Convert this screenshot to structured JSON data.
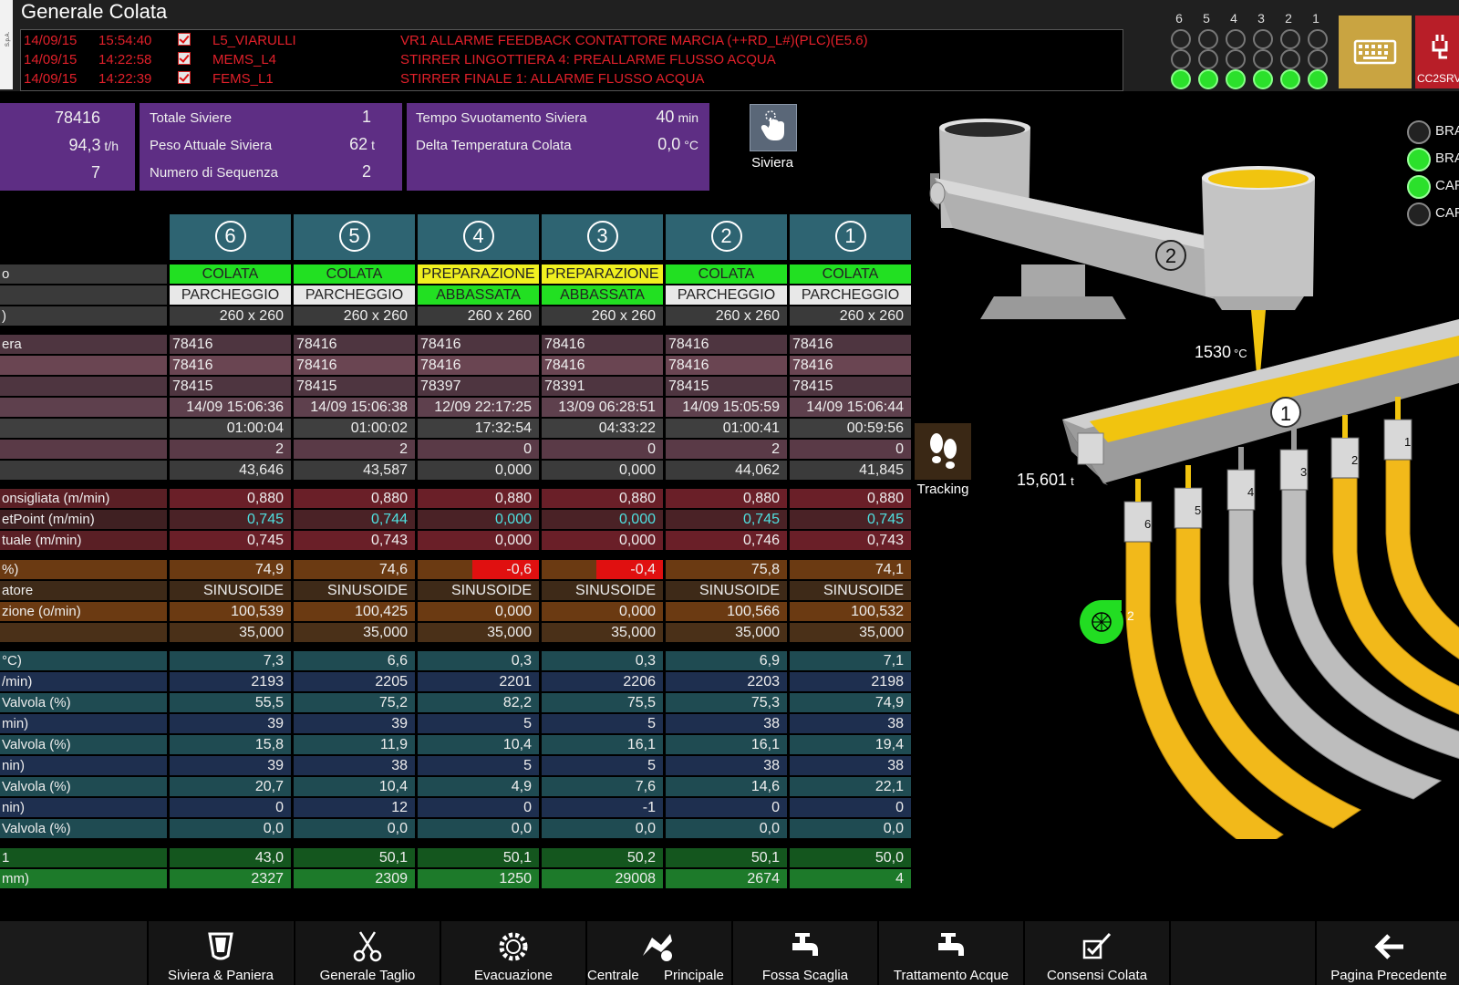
{
  "header": {
    "title": "Generale Colata",
    "logo_text": "S.p.A.",
    "alarms": [
      {
        "date": "14/09/15",
        "time": "15:54:40",
        "source": "L5_VIARULLI",
        "message": "VR1 ALLARME FEEDBACK CONTATTORE MARCIA (++RD_L#)(PLC)(E5.6)"
      },
      {
        "date": "14/09/15",
        "time": "14:22:58",
        "source": "MEMS_L4",
        "message": "STIRRER LINGOTTIERA 4: PREALLARME FLUSSO ACQUA"
      },
      {
        "date": "14/09/15",
        "time": "14:22:39",
        "source": "FEMS_L1",
        "message": "STIRRER FINALE 1: ALLARME FLUSSO ACQUA"
      }
    ],
    "strand_leds": {
      "labels": [
        "6",
        "5",
        "4",
        "3",
        "2",
        "1"
      ],
      "row3_state": "on"
    },
    "keyboard_icon": "keyboard-icon",
    "cc2_label": "CC2SRV",
    "colors": {
      "alarm": "#e0202a",
      "led_on": "#2be02b",
      "panel": "#5e2e84"
    }
  },
  "panels": {
    "left": {
      "v1": "78416",
      "v2": "94,3",
      "v2_unit": "t/h",
      "v3": "7"
    },
    "mid": [
      {
        "label": "Totale Siviere",
        "value": "1",
        "unit": ""
      },
      {
        "label": "Peso Attuale Siviera",
        "value": "62",
        "unit": "t"
      },
      {
        "label": "Numero di Sequenza",
        "value": "2",
        "unit": ""
      }
    ],
    "right": [
      {
        "label": "Tempo Svuotamento Siviera",
        "value": "40",
        "unit": "min"
      },
      {
        "label": "Delta Temperatura Colata",
        "value": "0,0",
        "unit": "°C"
      }
    ],
    "siviera_button": "Siviera",
    "tracking_button": "Tracking"
  },
  "table": {
    "strands": [
      "6",
      "5",
      "4",
      "3",
      "2",
      "1"
    ],
    "state": [
      "COLATA",
      "COLATA",
      "PREPARAZIONE",
      "PREPARAZIONE",
      "COLATA",
      "COLATA"
    ],
    "state_color": [
      "#22e022",
      "#22e022",
      "#f0f020",
      "#f0f020",
      "#22e022",
      "#22e022"
    ],
    "mode": [
      "PARCHEGGIO",
      "PARCHEGGIO",
      "ABBASSATA",
      "ABBASSATA",
      "PARCHEGGIO",
      "PARCHEGGIO"
    ],
    "mode_color": [
      "#e8e8e8",
      "#e8e8e8",
      "#22e022",
      "#22e022",
      "#e8e8e8",
      "#e8e8e8"
    ],
    "row_labels": {
      "state": "o",
      "mode": "",
      "format": ")",
      "g1_0": "era",
      "g3_0": "onsigliata (m/min)",
      "g3_1": "etPoint (m/min)",
      "g3_2": "tuale (m/min)",
      "g4_0": "%)",
      "g4_1": "atore",
      "g4_2": "zione (o/min)",
      "g5_0": "°C)",
      "g5_1": "/min)",
      "g5_2": "Valvola (%)",
      "g5_3": "min)",
      "g5_4": "Valvola (%)",
      "g5_5": "nin)",
      "g5_6": "Valvola (%)",
      "g5_7": "nin)",
      "g5_8": "Valvola (%)",
      "g6_0": "1",
      "g6_1": "mm)"
    },
    "format": [
      "260 x 260",
      "260 x 260",
      "260 x 260",
      "260 x 260",
      "260 x 260",
      "260 x 260"
    ],
    "seq1": [
      "78416",
      "78416",
      "78416",
      "78416",
      "78416",
      "78416"
    ],
    "seq2": [
      "78416",
      "78416",
      "78416",
      "78416",
      "78416",
      "78416"
    ],
    "seq3": [
      "78415",
      "78415",
      "78397",
      "78391",
      "78415",
      "78415"
    ],
    "start": [
      "14/09 15:06:36",
      "14/09 15:06:38",
      "12/09 22:17:25",
      "13/09 06:28:51",
      "14/09 15:05:59",
      "14/09 15:06:44"
    ],
    "duration": [
      "01:00:04",
      "01:00:02",
      "17:32:54",
      "04:33:22",
      "01:00:41",
      "00:59:56"
    ],
    "count": [
      "2",
      "2",
      "0",
      "0",
      "2",
      "0"
    ],
    "weight": [
      "43,646",
      "43,587",
      "0,000",
      "0,000",
      "44,062",
      "41,845"
    ],
    "v_cons": [
      "0,880",
      "0,880",
      "0,880",
      "0,880",
      "0,880",
      "0,880"
    ],
    "v_set": [
      "0,745",
      "0,744",
      "0,000",
      "0,000",
      "0,745",
      "0,745"
    ],
    "v_act": [
      "0,745",
      "0,743",
      "0,000",
      "0,000",
      "0,746",
      "0,743"
    ],
    "pct": [
      "74,9",
      "74,6",
      "-0,6",
      "-0,4",
      "75,8",
      "74,1"
    ],
    "osc_type": [
      "SINUSOIDE",
      "SINUSOIDE",
      "SINUSOIDE",
      "SINUSOIDE",
      "SINUSOIDE",
      "SINUSOIDE"
    ],
    "osc_freq": [
      "100,539",
      "100,425",
      "0,000",
      "0,000",
      "100,566",
      "100,532"
    ],
    "osc_x": [
      "35,000",
      "35,000",
      "35,000",
      "35,000",
      "35,000",
      "35,000"
    ],
    "w_dt": [
      "7,3",
      "6,6",
      "0,3",
      "0,3",
      "6,9",
      "7,1"
    ],
    "w_flow": [
      "2193",
      "2205",
      "2201",
      "2206",
      "2203",
      "2198"
    ],
    "w_valve": [
      "55,5",
      "75,2",
      "82,2",
      "75,5",
      "75,3",
      "74,9"
    ],
    "z1_flow": [
      "39",
      "39",
      "5",
      "5",
      "38",
      "38"
    ],
    "z1_valve": [
      "15,8",
      "11,9",
      "10,4",
      "16,1",
      "16,1",
      "19,4"
    ],
    "z2_flow": [
      "39",
      "38",
      "5",
      "5",
      "38",
      "38"
    ],
    "z2_valve": [
      "20,7",
      "10,4",
      "4,9",
      "7,6",
      "14,6",
      "22,1"
    ],
    "z3_flow": [
      "0",
      "12",
      "0",
      "-1",
      "0",
      "0"
    ],
    "z3_valve": [
      "0,0",
      "0,0",
      "0,0",
      "0,0",
      "0,0",
      "0,0"
    ],
    "g6_a": [
      "43,0",
      "50,1",
      "50,1",
      "50,2",
      "50,1",
      "50,0"
    ],
    "g6_b": [
      "2327",
      "2309",
      "1250",
      "29008",
      "2674",
      "4"
    ]
  },
  "plant": {
    "ladle_num": "2",
    "tundish_num": "1",
    "temp": "1530",
    "temp_unit": "°C",
    "tundish_weight": "15,601",
    "tundish_weight_unit": "t",
    "strand_labels": [
      "6",
      "5",
      "4",
      "3",
      "2",
      "1"
    ],
    "pump_label": "2",
    "side_items": [
      {
        "label": "BRA",
        "on": false
      },
      {
        "label": "BRA",
        "on": true
      },
      {
        "label": "CAR",
        "on": true
      },
      {
        "label": "CAR",
        "on": false
      }
    ]
  },
  "nav": [
    {
      "label": "Siviera & Paniera",
      "icon": "ladle-icon"
    },
    {
      "label": "Generale Taglio",
      "icon": "scissors-icon"
    },
    {
      "label": "Evacuazione",
      "icon": "gear-icon"
    },
    {
      "label": "Centrale",
      "icon": "hydraulic-icon"
    },
    {
      "label": "Principale",
      "icon": "hydraulic-icon"
    },
    {
      "label": "Fossa Scaglia",
      "icon": "faucet-icon"
    },
    {
      "label": "Trattamento Acque",
      "icon": "faucet-icon"
    },
    {
      "label": "Consensi Colata",
      "icon": "checkbox-icon"
    },
    {
      "label": "Pagina Precedente",
      "icon": "arrow-left-icon"
    }
  ]
}
